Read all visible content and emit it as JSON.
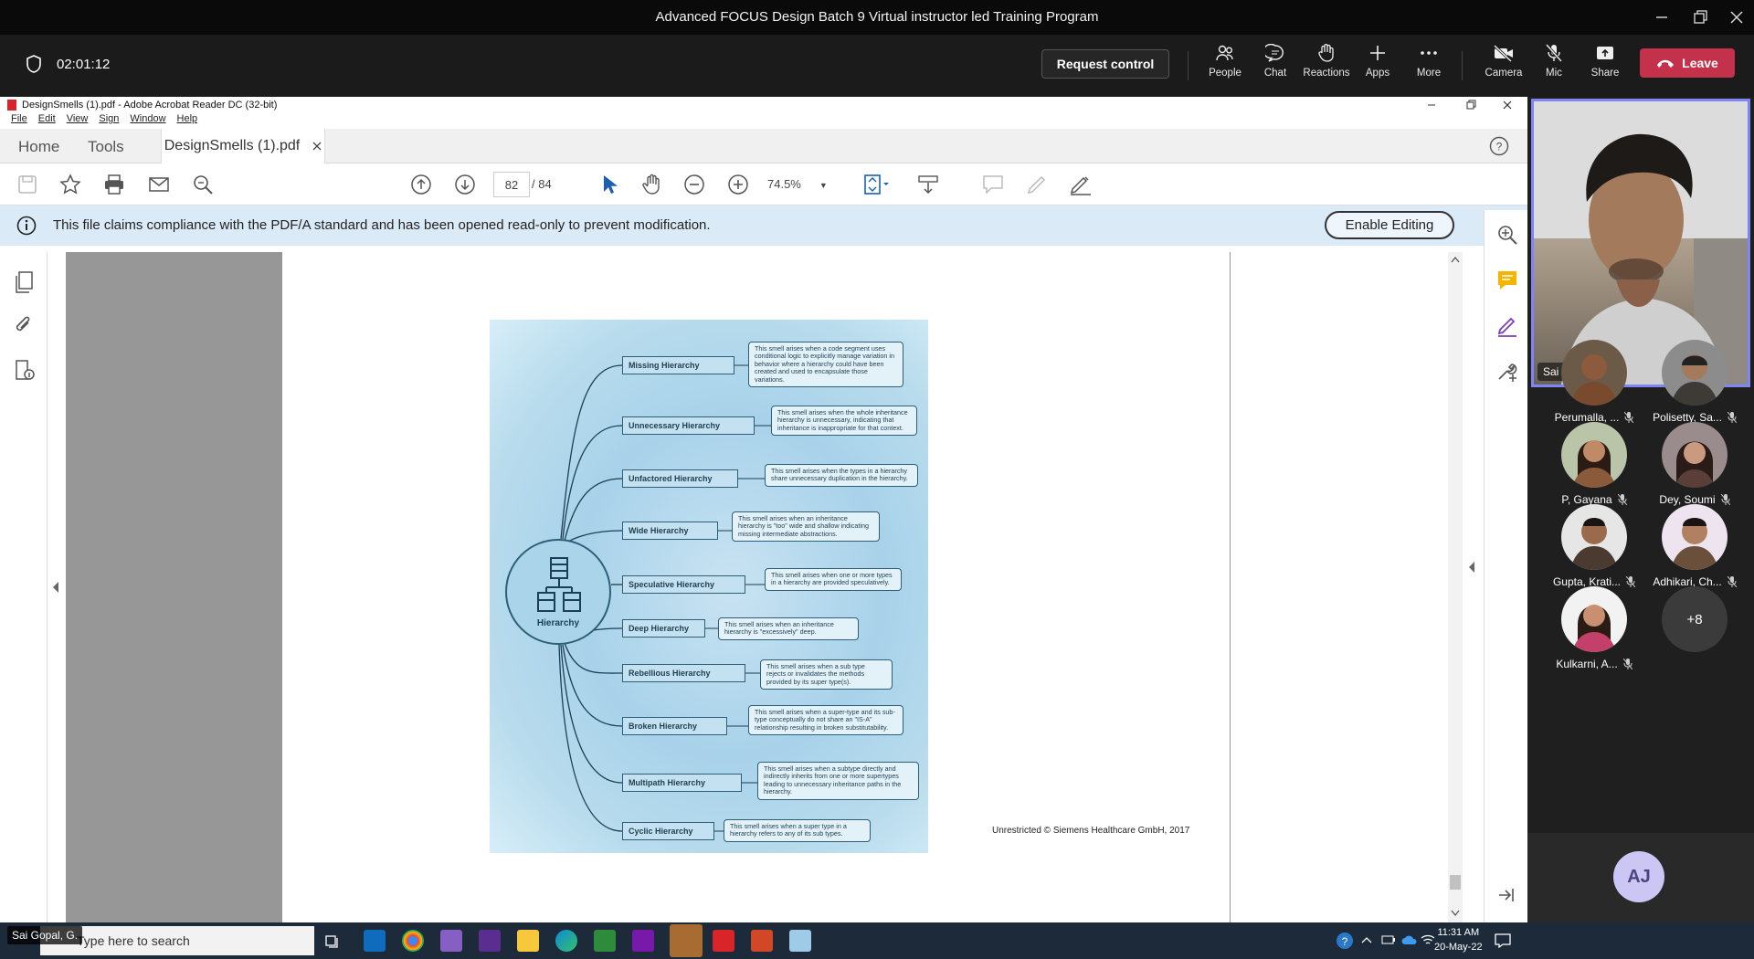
{
  "window": {
    "title": "Advanced FOCUS Design Batch 9 Virtual instructor led Training Program"
  },
  "meeting": {
    "timer": "02:01:12",
    "request_control": "Request control",
    "buttons": [
      {
        "label": "People",
        "icon": "people-icon"
      },
      {
        "label": "Chat",
        "icon": "chat-icon"
      },
      {
        "label": "Reactions",
        "icon": "reactions-icon"
      },
      {
        "label": "Apps",
        "icon": "apps-icon"
      },
      {
        "label": "More",
        "icon": "more-icon"
      },
      {
        "label": "Camera",
        "icon": "camera-off-icon"
      },
      {
        "label": "Mic",
        "icon": "mic-off-icon"
      },
      {
        "label": "Share",
        "icon": "share-icon"
      }
    ],
    "leave": "Leave"
  },
  "acrobat": {
    "title": "DesignSmells (1).pdf - Adobe Acrobat Reader DC (32-bit)",
    "menu": [
      "File",
      "Edit",
      "View",
      "Sign",
      "Window",
      "Help"
    ],
    "tabs": {
      "home": "Home",
      "tools": "Tools",
      "doc": "DesignSmells (1).pdf"
    },
    "page_current": "82",
    "page_total": "/ 84",
    "zoom": "74.5%",
    "info_message": "This file claims compliance with the PDF/A standard and has been opened read-only to prevent modification.",
    "enable_editing": "Enable Editing"
  },
  "slide": {
    "hub_label": "Hierarchy",
    "smells": [
      {
        "name": "Missing Hierarchy",
        "desc": "This smell arises when a code segment uses conditional logic to explicitly manage variation in behavior where a hierarchy could have been created and used to encapsulate those variations."
      },
      {
        "name": "Unnecessary Hierarchy",
        "desc": "This smell arises when the whole inheritance hierarchy is unnecessary, indicating that inheritance is inappropriate for that context."
      },
      {
        "name": "Unfactored Hierarchy",
        "desc": "This smell arises when the types in a hierarchy share unnecessary duplication in the hierarchy."
      },
      {
        "name": "Wide Hierarchy",
        "desc": "This smell arises when an inheritance hierarchy is \"too\" wide and shallow indicating missing intermediate abstractions."
      },
      {
        "name": "Speculative Hierarchy",
        "desc": "This smell arises when one or more types in a hierarchy are provided speculatively."
      },
      {
        "name": "Deep Hierarchy",
        "desc": "This smell arises when an inheritance hierarchy is \"excessively\" deep."
      },
      {
        "name": "Rebellious Hierarchy",
        "desc": "This smell arises when a sub type rejects or invalidates the methods provided by its super type(s)."
      },
      {
        "name": "Broken Hierarchy",
        "desc": "This smell arises when a super-type and its sub-type conceptually do not share an \"IS-A\" relationship resulting in broken substitutability."
      },
      {
        "name": "Multipath Hierarchy",
        "desc": "This smell arises when a subtype directly and indirectly inherits from one or more supertypes leading to unnecessary inheritance paths in the hierarchy."
      },
      {
        "name": "Cyclic Hierarchy",
        "desc": "This smell arises when a super type in a hierarchy refers to any of its sub types."
      }
    ],
    "copyright": "Unrestricted © Siemens Healthcare GmbH, 2017"
  },
  "video": {
    "self_name": "Sai Gopal, G.",
    "participants": [
      {
        "name": "Perumalla, ...",
        "color": "#7a4a2e"
      },
      {
        "name": "Polisetty, Sa...",
        "color": "#3e3a36"
      },
      {
        "name": "P, Gayana",
        "color": "#8a5a3a"
      },
      {
        "name": "Dey, Soumi",
        "color": "#5a3f38"
      },
      {
        "name": "Gupta, Krati...",
        "color": "#4a3a30"
      },
      {
        "name": "Adhikari, Ch...",
        "color": "#6a4f3a"
      },
      {
        "name": "Kulkarni, A...",
        "color": "#c2406a"
      }
    ],
    "more_count": "+8",
    "aj_initials": "AJ"
  },
  "taskbar": {
    "search_placeholder": "Type here to search",
    "overlay_name": "Sai Gopal, G.",
    "time": "11:31 AM",
    "date": "20-May-22"
  }
}
